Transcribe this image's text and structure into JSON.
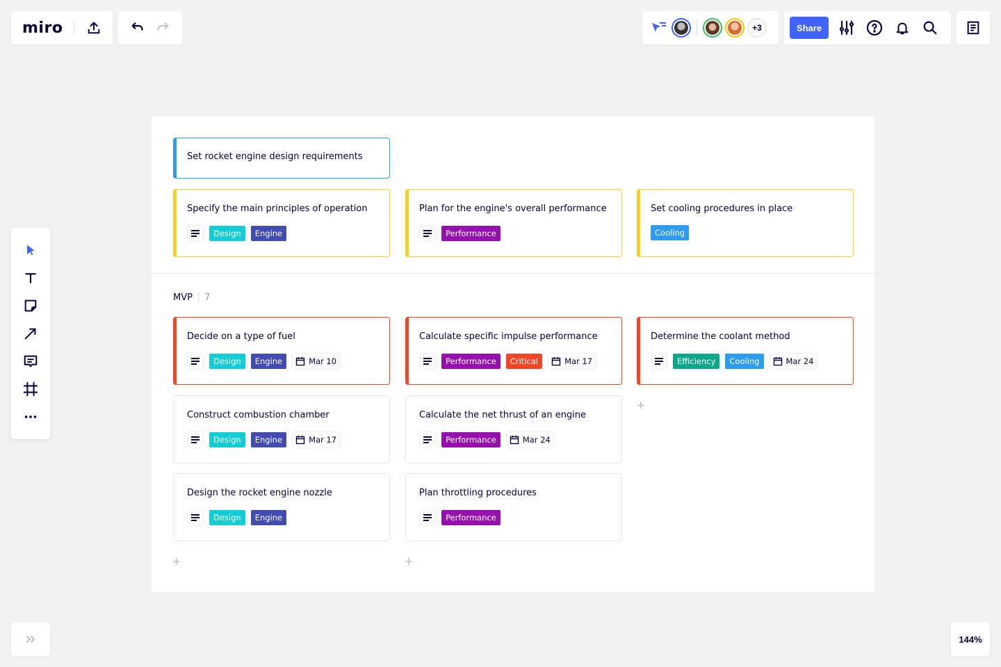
{
  "app": {
    "logo": "miro",
    "share_label": "Share",
    "collaborators_more": "+3",
    "zoom_level": "144%"
  },
  "colors": {
    "accent": "#4262ff",
    "tag_design": "#12cdd4",
    "tag_engine": "#414bb2",
    "tag_performance": "#9510ac",
    "tag_cooling": "#2d9bf0",
    "tag_critical": "#f24726",
    "tag_efficiency": "#0ca789",
    "card_blue": "#2d9bf0",
    "card_yellow": "#fac710",
    "card_red": "#f24726"
  },
  "toolbar": {
    "tools": [
      "select-tool",
      "text-tool",
      "sticky-note-tool",
      "connection-line-tool",
      "comment-tool",
      "frame-tool",
      "more-tools"
    ]
  },
  "board": {
    "top_cards": [
      {
        "title": "Set rocket engine design requirements",
        "style": "blue",
        "tags": []
      },
      {
        "title": "Specify the main principles of operation",
        "style": "yellow",
        "desc": true,
        "tags": [
          {
            "label": "Design",
            "color": "#12cdd4"
          },
          {
            "label": "Engine",
            "color": "#414bb2"
          }
        ]
      },
      {
        "title": "Plan for the engine's overall performance",
        "style": "yellow",
        "desc": true,
        "tags": [
          {
            "label": "Performance",
            "color": "#9510ac"
          }
        ]
      },
      {
        "title": "Set cooling procedures in place",
        "style": "yellow",
        "desc": false,
        "tags": [
          {
            "label": "Cooling",
            "color": "#2d9bf0"
          }
        ]
      }
    ],
    "section": {
      "label": "MVP",
      "count": "7"
    },
    "mvp_cards": [
      {
        "title": "Decide on a type of fuel",
        "style": "red",
        "tags": [
          {
            "label": "Design",
            "color": "#12cdd4"
          },
          {
            "label": "Engine",
            "color": "#414bb2"
          }
        ],
        "date": "Mar 10"
      },
      {
        "title": "Calculate specific impulse performance",
        "style": "red",
        "tags": [
          {
            "label": "Performance",
            "color": "#9510ac"
          },
          {
            "label": "Critical",
            "color": "#f24726"
          }
        ],
        "date": "Mar 17"
      },
      {
        "title": "Determine the coolant method",
        "style": "red",
        "tags": [
          {
            "label": "Efficiency",
            "color": "#0ca789"
          },
          {
            "label": "Cooling",
            "color": "#2d9bf0"
          }
        ],
        "date": "Mar 24"
      },
      {
        "title": "Construct combustion chamber",
        "style": "plain",
        "tags": [
          {
            "label": "Design",
            "color": "#12cdd4"
          },
          {
            "label": "Engine",
            "color": "#414bb2"
          }
        ],
        "date": "Mar 17"
      },
      {
        "title": "Calculate the net thrust of an engine",
        "style": "plain",
        "tags": [
          {
            "label": "Performance",
            "color": "#9510ac"
          }
        ],
        "date": "Mar 24"
      },
      {
        "title": "Design the rocket engine nozzle",
        "style": "plain",
        "tags": [
          {
            "label": "Design",
            "color": "#12cdd4"
          },
          {
            "label": "Engine",
            "color": "#414bb2"
          }
        ],
        "date": null
      },
      {
        "title": "Plan throttling procedures",
        "style": "plain",
        "tags": [
          {
            "label": "Performance",
            "color": "#9510ac"
          }
        ],
        "date": null
      }
    ],
    "add_label": "+"
  }
}
